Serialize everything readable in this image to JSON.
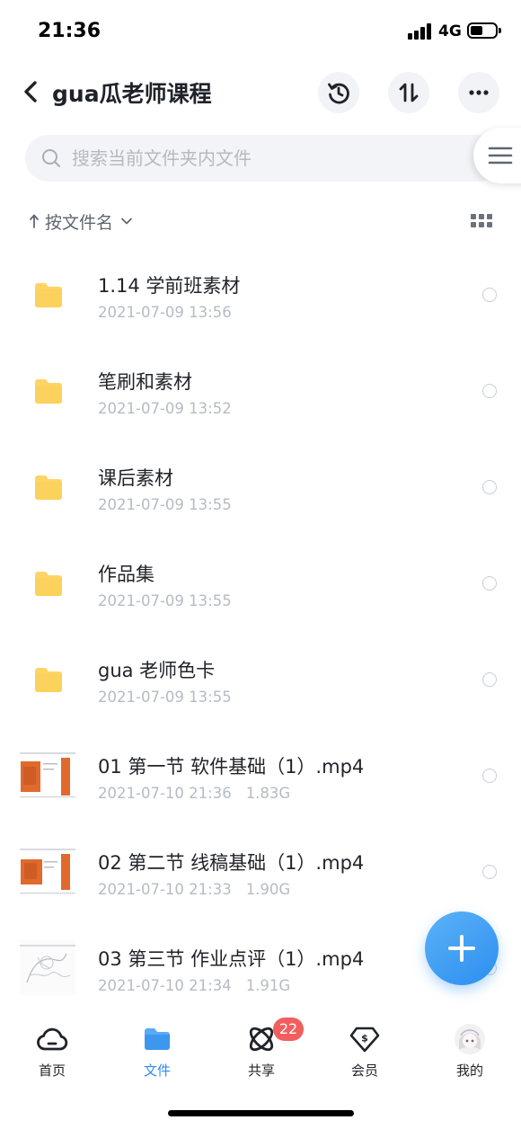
{
  "status_bar": {
    "time": "21:36",
    "network": "4G",
    "battery_level_percent": 40
  },
  "header": {
    "title": "gua瓜老师课程",
    "back_icon": "chevron-left-icon",
    "actions": [
      "history-icon",
      "transfer-icon",
      "more-icon"
    ]
  },
  "search": {
    "placeholder": "搜索当前文件夹内文件",
    "value": ""
  },
  "sort": {
    "label": "按文件名"
  },
  "files": [
    {
      "name": "1.14 学前班素材",
      "date": "2021-07-09 13:56",
      "size": "",
      "type": "folder"
    },
    {
      "name": "笔刷和素材",
      "date": "2021-07-09 13:52",
      "size": "",
      "type": "folder"
    },
    {
      "name": "课后素材",
      "date": "2021-07-09 13:55",
      "size": "",
      "type": "folder"
    },
    {
      "name": "作品集",
      "date": "2021-07-09 13:55",
      "size": "",
      "type": "folder"
    },
    {
      "name": "gua 老师色卡",
      "date": "2021-07-09 13:55",
      "size": "",
      "type": "folder"
    },
    {
      "name": "01 第一节 软件基础（1）.mp4",
      "date": "2021-07-10 21:36",
      "size": "1.83G",
      "type": "video"
    },
    {
      "name": "02 第二节 线稿基础（1）.mp4",
      "date": "2021-07-10 21:33",
      "size": "1.90G",
      "type": "video"
    },
    {
      "name": "03 第三节 作业点评（1）.mp4",
      "date": "2021-07-10 21:34",
      "size": "1.91G",
      "type": "video"
    }
  ],
  "bottom_nav": {
    "items": [
      {
        "label": "首页",
        "icon": "cloud-icon"
      },
      {
        "label": "文件",
        "icon": "folder-icon"
      },
      {
        "label": "共享",
        "icon": "share-orbit-icon"
      },
      {
        "label": "会员",
        "icon": "vip-diamond-icon"
      },
      {
        "label": "我的",
        "icon": "avatar"
      }
    ],
    "share_badge": "22",
    "active_index": 1
  },
  "colors": {
    "accent": "#2d8cf0",
    "folder": "#fdd466",
    "badge": "#f25e5e",
    "muted_text": "#b7bbc2"
  }
}
